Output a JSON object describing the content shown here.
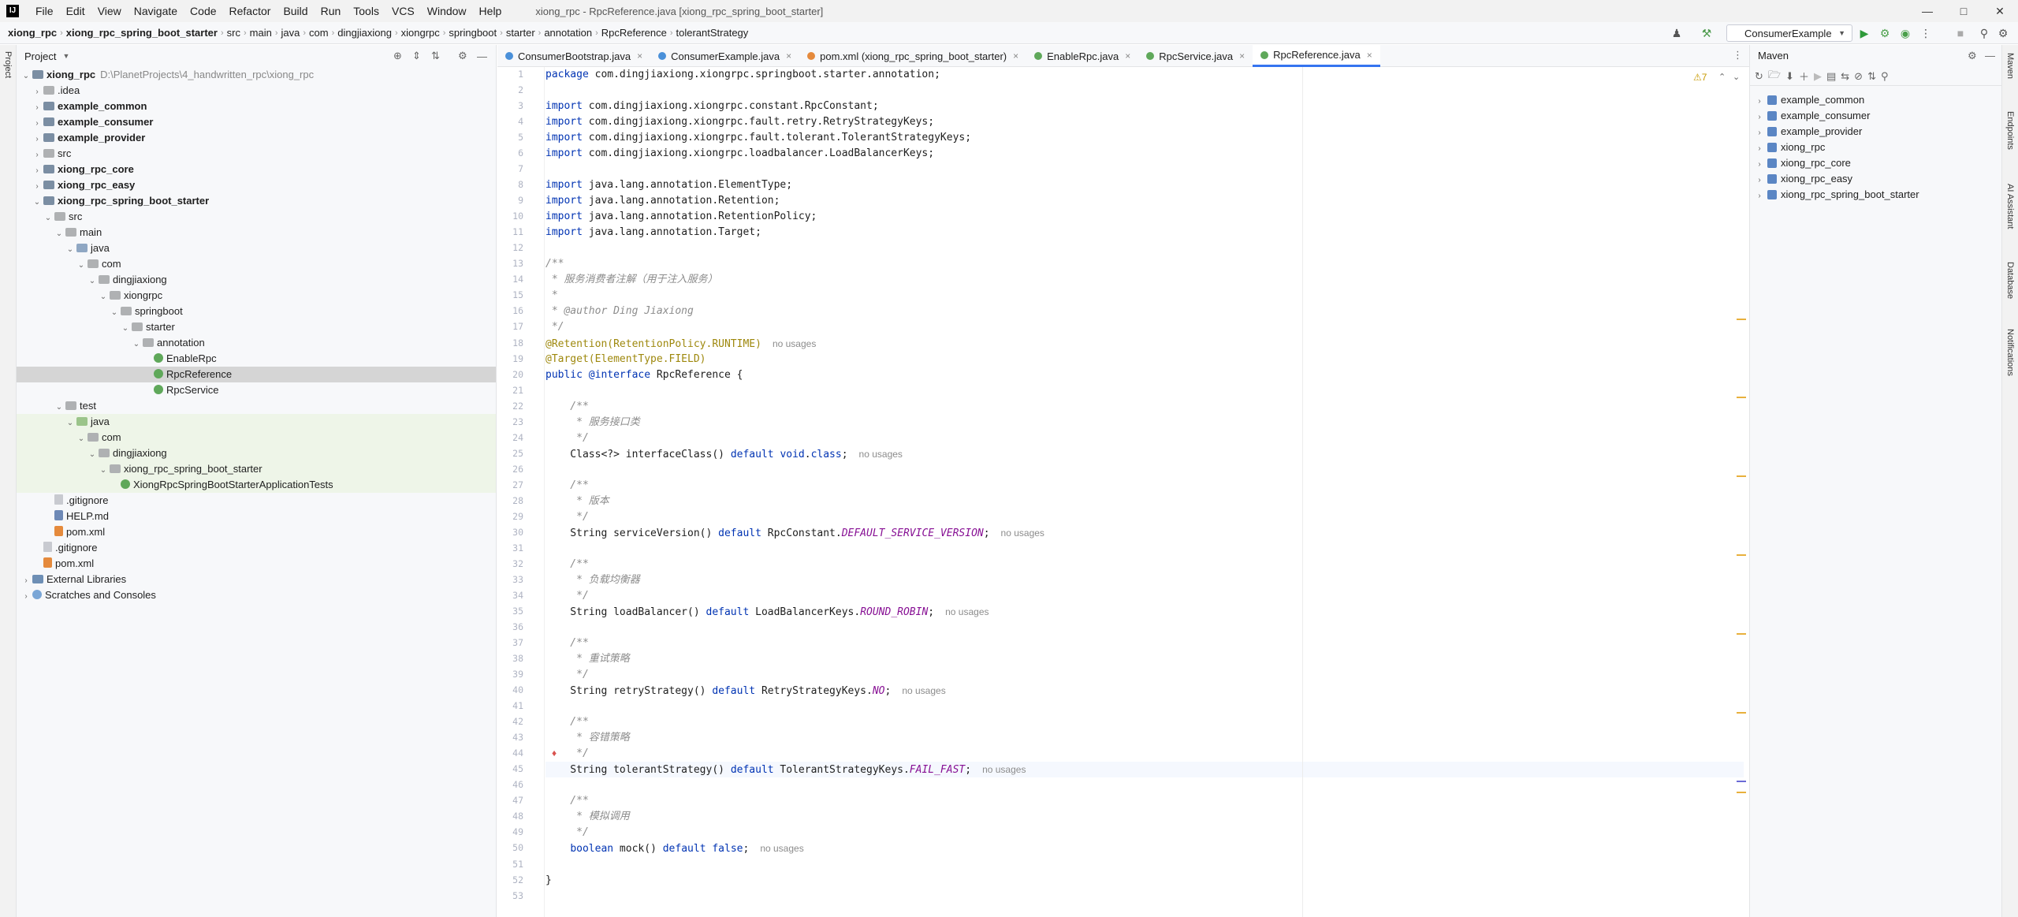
{
  "window": {
    "title": "xiong_rpc - RpcReference.java [xiong_rpc_spring_boot_starter]",
    "menu": [
      "File",
      "Edit",
      "View",
      "Navigate",
      "Code",
      "Refactor",
      "Build",
      "Run",
      "Tools",
      "VCS",
      "Window",
      "Help"
    ]
  },
  "breadcrumb": [
    "xiong_rpc",
    "xiong_rpc_spring_boot_starter",
    "src",
    "main",
    "java",
    "com",
    "dingjiaxiong",
    "xiongrpc",
    "springboot",
    "starter",
    "annotation",
    "RpcReference",
    "tolerantStrategy"
  ],
  "run_config": "ConsumerExample",
  "project_panel": {
    "title": "Project",
    "root_path": "D:\\PlanetProjects\\4_handwritten_rpc\\xiong_rpc",
    "tree": [
      {
        "label": "xiong_rpc",
        "level": 0,
        "arrow": "v",
        "icon": "module",
        "bold": true,
        "path": true
      },
      {
        "label": ".idea",
        "level": 1,
        "arrow": ">",
        "icon": "folder"
      },
      {
        "label": "example_common",
        "level": 1,
        "arrow": ">",
        "icon": "module",
        "bold": true
      },
      {
        "label": "example_consumer",
        "level": 1,
        "arrow": ">",
        "icon": "module",
        "bold": true
      },
      {
        "label": "example_provider",
        "level": 1,
        "arrow": ">",
        "icon": "module",
        "bold": true
      },
      {
        "label": "src",
        "level": 1,
        "arrow": ">",
        "icon": "folder"
      },
      {
        "label": "xiong_rpc_core",
        "level": 1,
        "arrow": ">",
        "icon": "module",
        "bold": true
      },
      {
        "label": "xiong_rpc_easy",
        "level": 1,
        "arrow": ">",
        "icon": "module",
        "bold": true
      },
      {
        "label": "xiong_rpc_spring_boot_starter",
        "level": 1,
        "arrow": "v",
        "icon": "module",
        "bold": true
      },
      {
        "label": "src",
        "level": 2,
        "arrow": "v",
        "icon": "folder"
      },
      {
        "label": "main",
        "level": 3,
        "arrow": "v",
        "icon": "folder"
      },
      {
        "label": "java",
        "level": 4,
        "arrow": "v",
        "icon": "src"
      },
      {
        "label": "com",
        "level": 5,
        "arrow": "v",
        "icon": "folder"
      },
      {
        "label": "dingjiaxiong",
        "level": 6,
        "arrow": "v",
        "icon": "folder"
      },
      {
        "label": "xiongrpc",
        "level": 7,
        "arrow": "v",
        "icon": "folder"
      },
      {
        "label": "springboot",
        "level": 8,
        "arrow": "v",
        "icon": "folder"
      },
      {
        "label": "starter",
        "level": 9,
        "arrow": "v",
        "icon": "folder"
      },
      {
        "label": "annotation",
        "level": 10,
        "arrow": "v",
        "icon": "folder"
      },
      {
        "label": "EnableRpc",
        "level": 11,
        "arrow": "",
        "icon": "cls"
      },
      {
        "label": "RpcReference",
        "level": 11,
        "arrow": "",
        "icon": "cls",
        "selected": true
      },
      {
        "label": "RpcService",
        "level": 11,
        "arrow": "",
        "icon": "cls"
      },
      {
        "label": "test",
        "level": 3,
        "arrow": "v",
        "icon": "folder"
      },
      {
        "label": "java",
        "level": 4,
        "arrow": "v",
        "icon": "testf",
        "test": true
      },
      {
        "label": "com",
        "level": 5,
        "arrow": "v",
        "icon": "folder",
        "test": true
      },
      {
        "label": "dingjiaxiong",
        "level": 6,
        "arrow": "v",
        "icon": "folder",
        "test": true
      },
      {
        "label": "xiong_rpc_spring_boot_starter",
        "level": 7,
        "arrow": "v",
        "icon": "folder",
        "test": true
      },
      {
        "label": "XiongRpcSpringBootStarterApplicationTests",
        "level": 8,
        "arrow": "",
        "icon": "cls",
        "test": true
      },
      {
        "label": ".gitignore",
        "level": 2,
        "arrow": "",
        "icon": "file"
      },
      {
        "label": "HELP.md",
        "level": 2,
        "arrow": "",
        "icon": "md"
      },
      {
        "label": "pom.xml",
        "level": 2,
        "arrow": "",
        "icon": "xml"
      },
      {
        "label": ".gitignore",
        "level": 1,
        "arrow": "",
        "icon": "file"
      },
      {
        "label": "pom.xml",
        "level": 1,
        "arrow": "",
        "icon": "xml"
      },
      {
        "label": "External Libraries",
        "level": 0,
        "arrow": ">",
        "icon": "lib"
      },
      {
        "label": "Scratches and Consoles",
        "level": 0,
        "arrow": ">",
        "icon": "scratch"
      }
    ]
  },
  "tabs": [
    {
      "label": "ConsumerBootstrap.java",
      "color": "#4a90d9"
    },
    {
      "label": "ConsumerExample.java",
      "color": "#4a90d9"
    },
    {
      "label": "pom.xml (xiong_rpc_spring_boot_starter)",
      "color": "#e58a3c"
    },
    {
      "label": "EnableRpc.java",
      "color": "#5fa85a"
    },
    {
      "label": "RpcService.java",
      "color": "#5fa85a"
    },
    {
      "label": "RpcReference.java",
      "color": "#5fa85a",
      "active": true
    }
  ],
  "inspection": {
    "warnings": "7"
  },
  "code": [
    "package com.dingjiaxiong.xiongrpc.springboot.starter.annotation;",
    "",
    "import com.dingjiaxiong.xiongrpc.constant.RpcConstant;",
    "import com.dingjiaxiong.xiongrpc.fault.retry.RetryStrategyKeys;",
    "import com.dingjiaxiong.xiongrpc.fault.tolerant.TolerantStrategyKeys;",
    "import com.dingjiaxiong.xiongrpc.loadbalancer.LoadBalancerKeys;",
    "",
    "import java.lang.annotation.ElementType;",
    "import java.lang.annotation.Retention;",
    "import java.lang.annotation.RetentionPolicy;",
    "import java.lang.annotation.Target;",
    "",
    "/**",
    " * 服务消费者注解（用于注入服务）",
    " *",
    " * @author Ding Jiaxiong",
    " */",
    "@Retention(RetentionPolicy.RUNTIME)",
    "@Target(ElementType.FIELD)",
    "public @interface RpcReference {",
    "",
    "    /**",
    "     * 服务接口类",
    "     */",
    "    Class<?> interfaceClass() default void.class;",
    "",
    "    /**",
    "     * 版本",
    "     */",
    "    String serviceVersion() default RpcConstant.DEFAULT_SERVICE_VERSION;",
    "",
    "    /**",
    "     * 负载均衡器",
    "     */",
    "    String loadBalancer() default LoadBalancerKeys.ROUND_ROBIN;",
    "",
    "    /**",
    "     * 重试策略",
    "     */",
    "    String retryStrategy() default RetryStrategyKeys.NO;",
    "",
    "    /**",
    "     * 容错策略",
    "     */",
    "    String tolerantStrategy() default TolerantStrategyKeys.FAIL_FAST;",
    "",
    "    /**",
    "     * 模拟调用",
    "     */",
    "    boolean mock() default false;",
    "",
    "}",
    ""
  ],
  "usage_hint": "no usages",
  "maven": {
    "title": "Maven",
    "projects": [
      "example_common",
      "example_consumer",
      "example_provider",
      "xiong_rpc",
      "xiong_rpc_core",
      "xiong_rpc_easy",
      "xiong_rpc_spring_boot_starter"
    ]
  },
  "side_stripes": {
    "left": [
      "Project"
    ],
    "right": [
      "Maven",
      "Endpoints",
      "AI Assistant",
      "Database",
      "Notifications"
    ]
  }
}
